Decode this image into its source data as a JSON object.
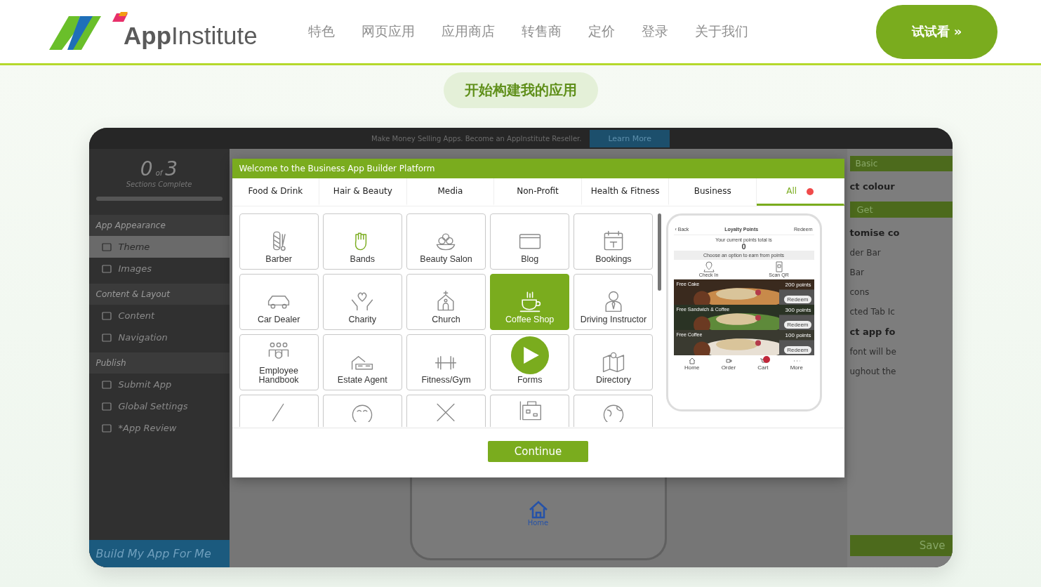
{
  "header": {
    "logo": "**App**Institute",
    "nav": [
      "特色",
      "网页应用",
      "应用商店",
      "转售商",
      "定价",
      "登录",
      "关于我们"
    ],
    "cta": "试试看 »"
  },
  "hero": {
    "pill": "开始构建我的应用"
  },
  "builder": {
    "banner": {
      "text": "Make Money Selling Apps. Become an AppInstitute Reseller.",
      "button": "Learn More"
    },
    "progress": {
      "done": "0",
      "of": "of",
      "total": "3",
      "caption": "Sections Complete",
      "level": 0
    },
    "sections": [
      {
        "title": "App Appearance",
        "items": [
          {
            "label": "Theme",
            "selected": true
          },
          {
            "label": "Images",
            "selected": false
          }
        ]
      },
      {
        "title": "Content & Layout",
        "items": [
          {
            "label": "Content",
            "selected": false
          },
          {
            "label": "Navigation",
            "selected": false
          }
        ]
      },
      {
        "title": "Publish",
        "items": [
          {
            "label": "Submit App",
            "selected": false
          },
          {
            "label": "Global Settings",
            "selected": false
          },
          {
            "label": "*App Review",
            "selected": false
          }
        ]
      }
    ],
    "build_button": "Build My App For Me",
    "settings": [
      {
        "kind": "header",
        "text": "Basic"
      },
      {
        "kind": "heading",
        "text": "ct colour"
      },
      {
        "kind": "button",
        "text": "Get"
      },
      {
        "kind": "heading",
        "text": "tomise co"
      },
      {
        "kind": "text",
        "text": "der Bar"
      },
      {
        "kind": "text",
        "text": "Bar"
      },
      {
        "kind": "text",
        "text": "cons"
      },
      {
        "kind": "text",
        "text": "cted Tab Ic"
      },
      {
        "kind": "heading",
        "text": "ct app fo"
      },
      {
        "kind": "text",
        "text": "font will be"
      },
      {
        "kind": "text",
        "text": "ughout the"
      },
      {
        "kind": "save",
        "text": "Save"
      }
    ],
    "preview_tab": "Home",
    "modal": {
      "title": "Welcome to the Business App Builder Platform",
      "tabs": [
        {
          "label": "Food & Drink",
          "selected": false
        },
        {
          "label": "Hair & Beauty",
          "selected": false
        },
        {
          "label": "Media",
          "selected": false
        },
        {
          "label": "Non-Profit",
          "selected": false
        },
        {
          "label": "Health & Fitness",
          "selected": false
        },
        {
          "label": "Business",
          "selected": false
        },
        {
          "label": "All",
          "selected": true
        }
      ],
      "tiles": [
        {
          "label": "Barber",
          "selected": false
        },
        {
          "label": "Bands",
          "selected": false
        },
        {
          "label": "Beauty Salon",
          "selected": false
        },
        {
          "label": "Blog",
          "selected": false
        },
        {
          "label": "Bookings",
          "selected": false
        },
        {
          "label": "Car Dealer",
          "selected": false
        },
        {
          "label": "Charity",
          "selected": false
        },
        {
          "label": "Church",
          "selected": false
        },
        {
          "label": "Coffee Shop",
          "selected": true
        },
        {
          "label": "Driving Instructor",
          "selected": false
        },
        {
          "label": "Employee Handbook",
          "selected": false
        },
        {
          "label": "Estate Agent",
          "selected": false
        },
        {
          "label": "Fitness/Gym",
          "selected": false
        },
        {
          "label": "Forms",
          "selected": false
        },
        {
          "label": "Directory",
          "selected": false
        }
      ],
      "phone": {
        "back": "‹ Back",
        "title": "Loyalty Points",
        "action": "Redeem",
        "points_caption": "Your current points total is",
        "points": "0",
        "choose": "Choose an option to earn from points",
        "options": [
          "Check In",
          "Scan QR"
        ],
        "offers": [
          {
            "name": "Free Cake",
            "points": "200 points",
            "button": "Redeem"
          },
          {
            "name": "Free Sandwich & Coffee",
            "points": "300 points",
            "button": "Redeem"
          },
          {
            "name": "Free Coffee",
            "points": "100 points",
            "button": "Redeem"
          }
        ],
        "tabbar": [
          "Home",
          "Order",
          "Cart",
          "More"
        ]
      },
      "continue": "Continue"
    }
  }
}
